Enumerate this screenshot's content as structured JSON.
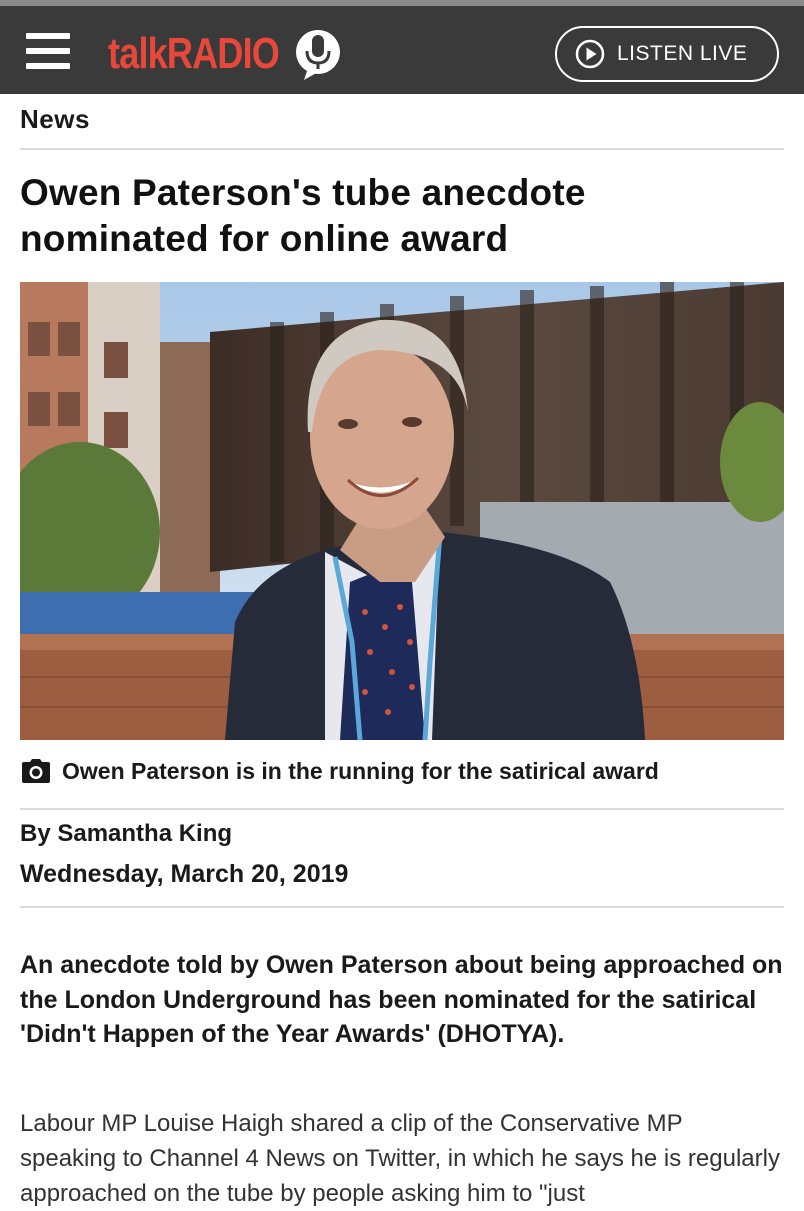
{
  "header": {
    "menu_icon": "hamburger-menu-icon",
    "logo_text": "talkRADIO",
    "logo_icon": "microphone-icon",
    "listen_label": "LISTEN LIVE",
    "listen_icon": "play-circle-icon",
    "brand_color": "#e8473a",
    "bar_color": "#3a3a3a"
  },
  "article": {
    "section": "News",
    "headline": "Owen Paterson's tube anecdote nominated for online award",
    "caption_icon": "camera-icon",
    "caption": "Owen Paterson is in the running for the satirical award",
    "byline": "By Samantha King",
    "date": "Wednesday, March 20, 2019",
    "lead": "An anecdote told by Owen Paterson about being approached on the London Underground has been nominated for the satirical 'Didn't Happen of the Year Awards' (DHOTYA).",
    "body": "Labour MP Louise Haigh shared a clip of the Conservative MP speaking to Channel 4 News on Twitter, in which he says he is regularly approached on the tube by people asking him to \"just"
  }
}
